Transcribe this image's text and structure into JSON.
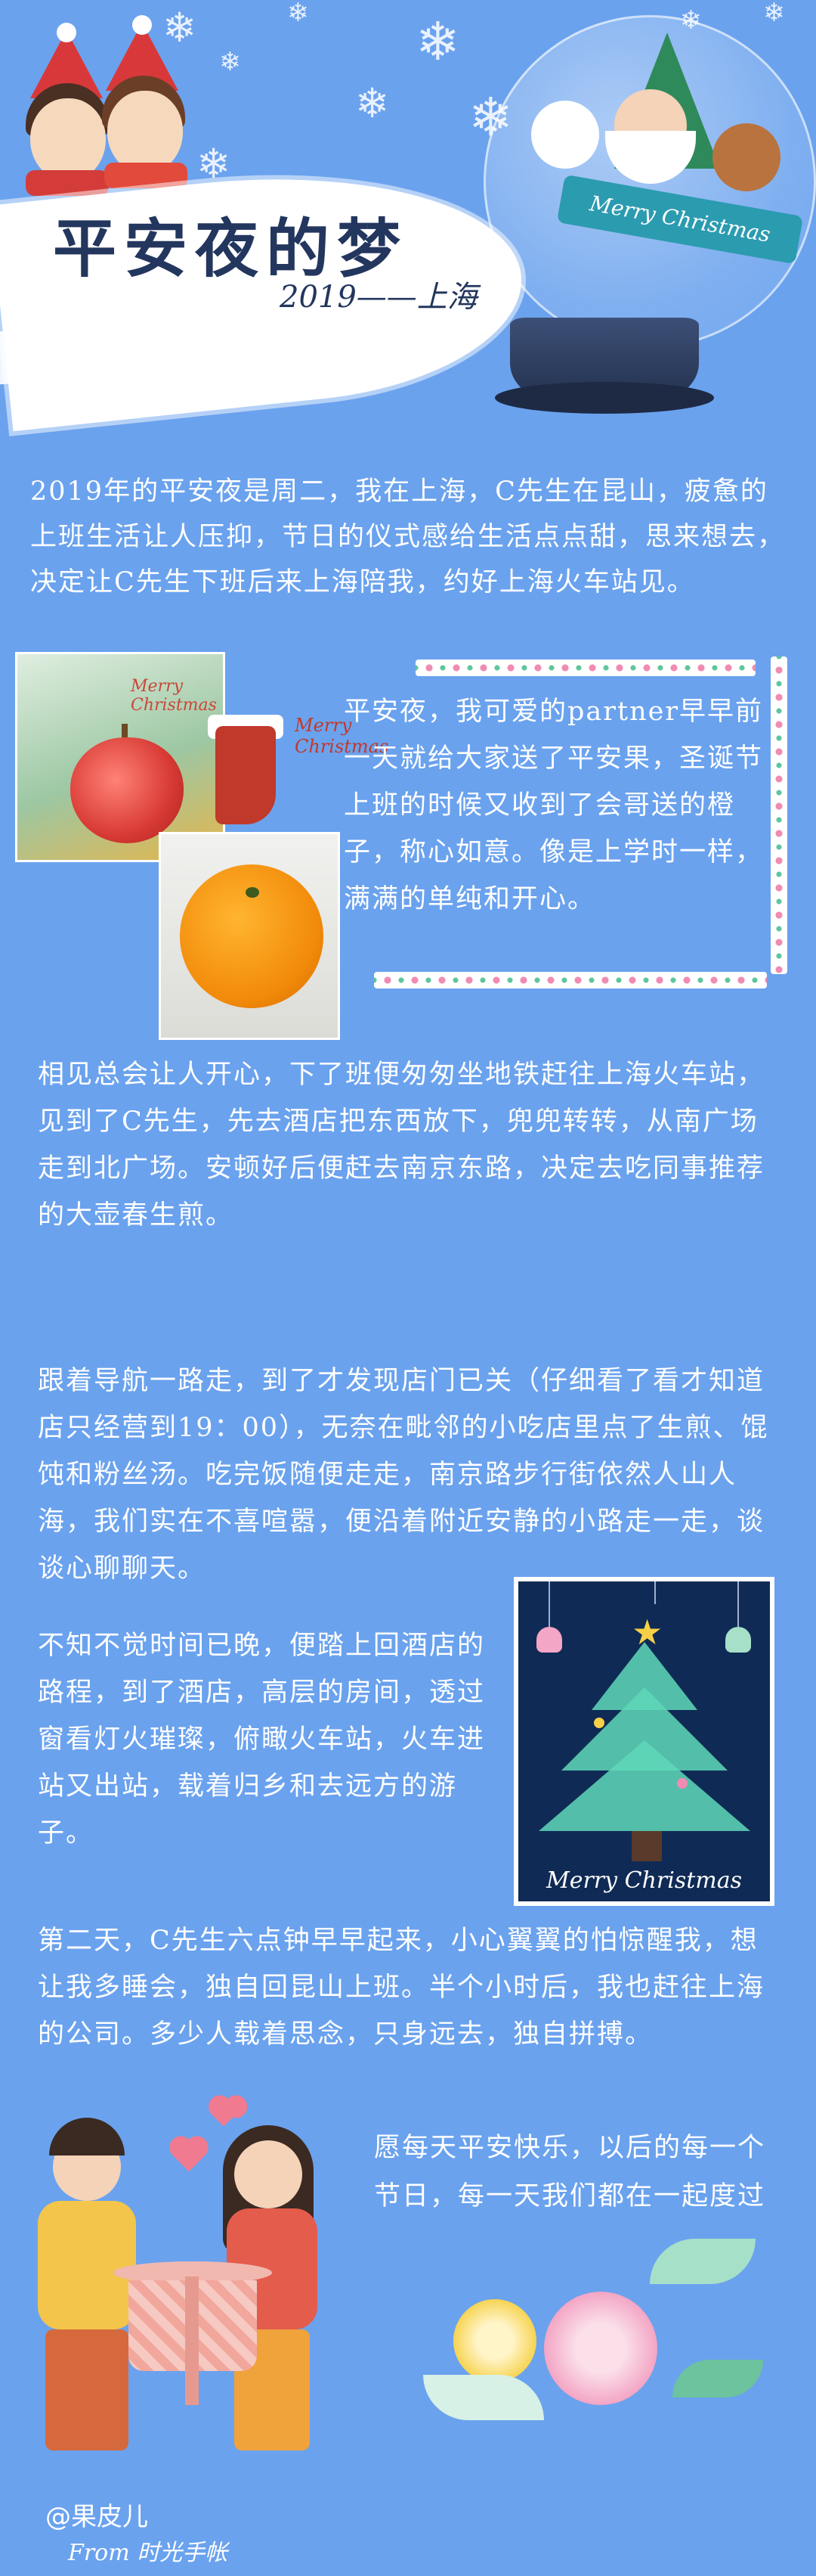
{
  "header": {
    "title": "平安夜的梦",
    "subtitle": "2019——上海",
    "globe_banner": "Merry Christmas"
  },
  "paragraphs": {
    "p1": "2019年的平安夜是周二，我在上海，C先生在昆山，疲惫的上班生活让人压抑，节日的仪式感给生活点点甜，思来想去，决定让C先生下班后来上海陪我，约好上海火车站见。",
    "p2": "平安夜，我可爱的partner早早前一天就给大家送了平安果，圣诞节上班的时候又收到了会哥送的橙子，称心如意。像是上学时一样，满满的单纯和开心。",
    "p3": "相见总会让人开心，下了班便匆匆坐地铁赶往上海火车站，见到了C先生，先去酒店把东西放下，兜兜转转，从南广场走到北广场。安顿好后便赶去南京东路，决定去吃同事推荐的大壶春生煎。",
    "p4": "跟着导航一路走，到了才发现店门已关（仔细看了看才知道店只经营到19：00），无奈在毗邻的小吃店里点了生煎、馄饨和粉丝汤。吃完饭随便走走，南京路步行街依然人山人海，我们实在不喜喧嚣，便沿着附近安静的小路走一走，谈谈心聊聊天。",
    "p5": "不知不觉时间已晚，便踏上回酒店的路程，到了酒店，高层的房间，透过窗看灯火璀璨，俯瞰火车站，火车进站又出站，载着归乡和去远方的游子。",
    "p6": "第二天，C先生六点钟早早起来，小心翼翼的怕惊醒我，想让我多睡会，独自回昆山上班。半个小时后，我也赶往上海的公司。多少人载着思念，只身远去，独自拼搏。",
    "p7": "愿每天平安快乐，以后的每一个节日，每一天我们都在一起度过"
  },
  "photos": {
    "apple_caption": "Merry Christmas",
    "stocking_caption": "Merry Christmas",
    "tree_caption": "Merry Christmas"
  },
  "footer": {
    "author": "@果皮儿",
    "from": "From 时光手帐"
  },
  "colors": {
    "background": "#6aa2ee",
    "title": "#23365e",
    "text": "#ffffff"
  }
}
